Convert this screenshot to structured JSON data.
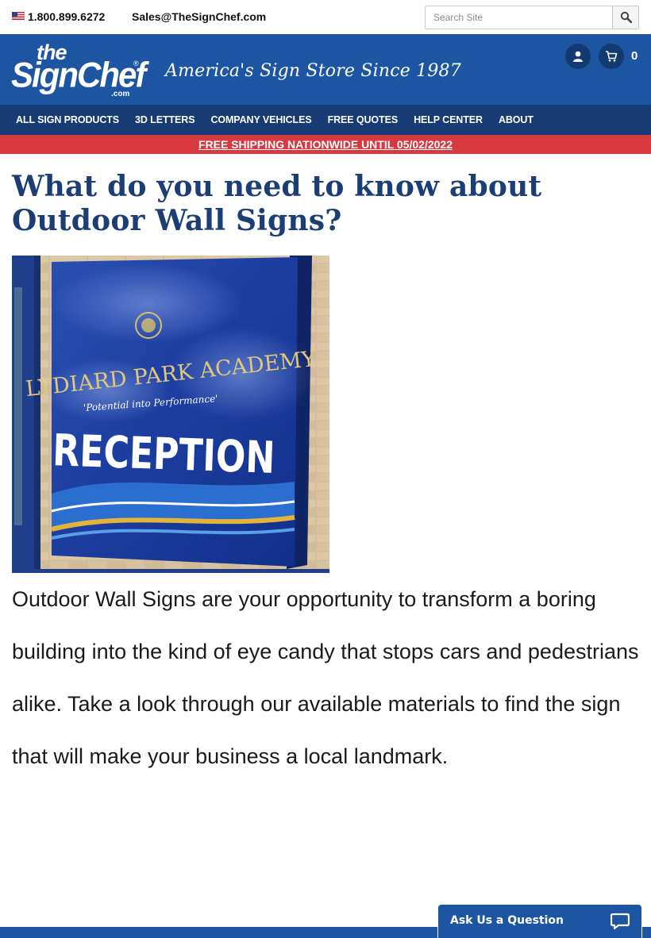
{
  "topbar": {
    "phone": "1.800.899.6272",
    "email": "Sales@TheSignChef.com",
    "search_placeholder": "Search Site",
    "flag_icon": "us-flag-icon"
  },
  "header": {
    "logo_the": "the",
    "logo_sign": "SignChef",
    "logo_com": ".com",
    "logo_reg": "®",
    "tagline": "America's Sign Store Since 1987",
    "cart_count": "0"
  },
  "nav": {
    "items": [
      {
        "label": "ALL SIGN PRODUCTS"
      },
      {
        "label": "3D LETTERS"
      },
      {
        "label": "COMPANY VEHICLES"
      },
      {
        "label": "FREE QUOTES"
      },
      {
        "label": "HELP CENTER"
      },
      {
        "label": "ABOUT"
      }
    ]
  },
  "promo": {
    "text": "FREE SHIPPING NATIONWIDE UNTIL 05/02/2022"
  },
  "main": {
    "title": "What do you need to know about Outdoor Wall Signs?",
    "photo": {
      "school": "LYDIARD PARK ACADEMY",
      "motto": "'Potential into Performance'",
      "word": "RECEPTION"
    },
    "body": "Outdoor Wall Signs are your opportunity to transform a boring building into the kind of eye candy that stops cars and pedestrians alike. Take a look through our available materials to find the sign that will make your business a local landmark."
  },
  "chat": {
    "label": "Ask Us a Question"
  },
  "colors": {
    "brand_blue": "#1d55a3",
    "nav_blue": "#163c73",
    "promo_red": "#d8393e",
    "title_navy": "#1b3f74"
  }
}
